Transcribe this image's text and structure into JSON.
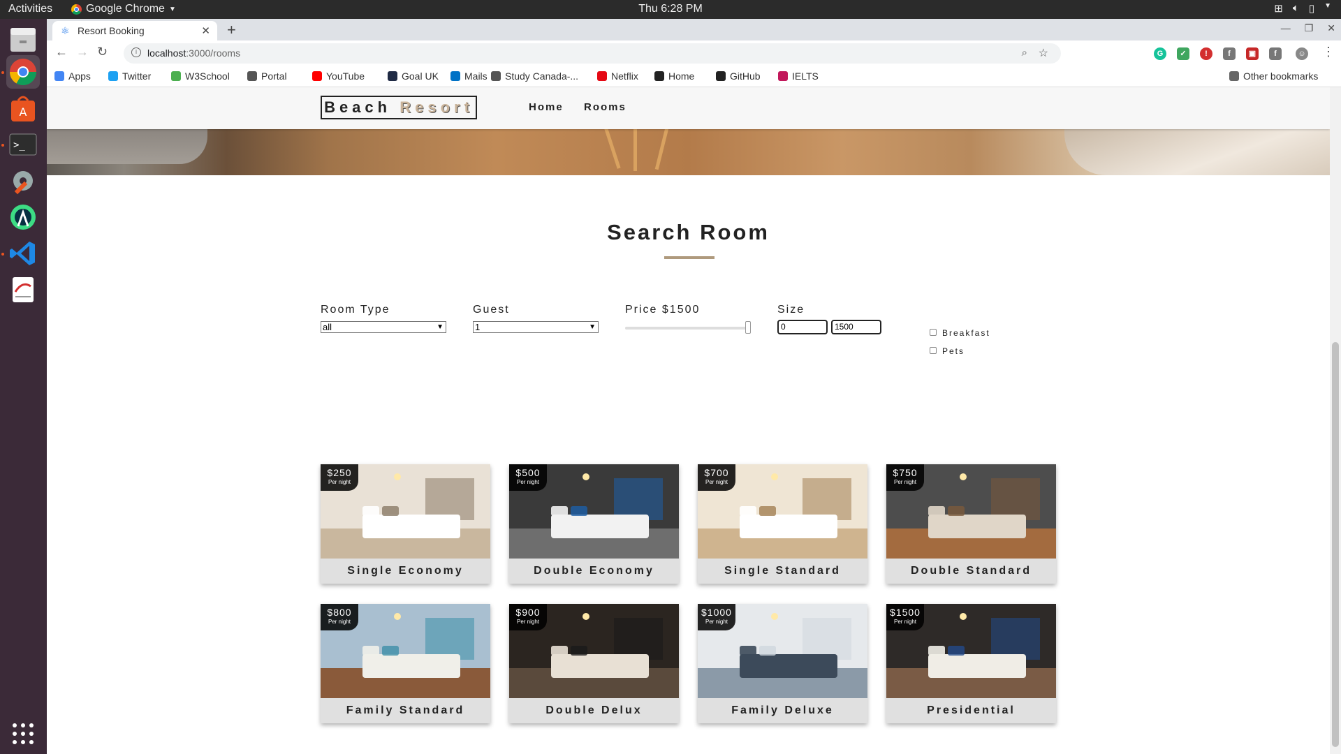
{
  "os": {
    "activities": "Activities",
    "app_name": "Google Chrome",
    "clock": "Thu  6:28 PM"
  },
  "browser": {
    "tab_title": "Resort Booking",
    "url_host": "localhost",
    "url_path": ":3000/rooms",
    "bookmarks": [
      {
        "label": "Apps",
        "icon": "apps-grid-icon",
        "color": "#4285f4"
      },
      {
        "label": "Twitter",
        "icon": "twitter-icon",
        "color": "#1da1f2"
      },
      {
        "label": "W3School",
        "icon": "w3school-icon",
        "color": "#4caf50"
      },
      {
        "label": "Portal",
        "icon": "globe-icon",
        "color": "#555555"
      },
      {
        "label": "YouTube",
        "icon": "youtube-icon",
        "color": "#ff0000"
      },
      {
        "label": "Goal UK",
        "icon": "goal-icon",
        "color": "#1f2a44"
      },
      {
        "label": "Mails",
        "icon": "outlook-icon",
        "color": "#0072c6"
      },
      {
        "label": "Study Canada-...",
        "icon": "globe-icon",
        "color": "#555555"
      },
      {
        "label": "Netflix",
        "icon": "netflix-icon",
        "color": "#e50914"
      },
      {
        "label": "Home",
        "icon": "home-site-icon",
        "color": "#222222"
      },
      {
        "label": "GitHub",
        "icon": "github-icon",
        "color": "#222222"
      },
      {
        "label": "IELTS",
        "icon": "ielts-icon",
        "color": "#c2185b"
      }
    ],
    "other_bookmarks": "Other bookmarks"
  },
  "site": {
    "logo_word1": "Beach",
    "logo_word2": "Resort",
    "nav": [
      "Home",
      "Rooms"
    ]
  },
  "search": {
    "title": "Search Room",
    "room_type_label": "Room Type",
    "room_type_value": "all",
    "guest_label": "Guest",
    "guest_value": "1",
    "price_label": "Price $1500",
    "price_fraction": 1.0,
    "size_label": "Size",
    "size_min": "0",
    "size_max": "1500",
    "breakfast_label": "Breakfast",
    "breakfast_checked": false,
    "pets_label": "Pets",
    "pets_checked": false
  },
  "rooms": [
    {
      "name": "Single Economy",
      "price": "$250",
      "per": "Per night"
    },
    {
      "name": "Double Economy",
      "price": "$500",
      "per": "Per night"
    },
    {
      "name": "Single Standard",
      "price": "$700",
      "per": "Per night"
    },
    {
      "name": "Double Standard",
      "price": "$750",
      "per": "Per night"
    },
    {
      "name": "Family Standard",
      "price": "$800",
      "per": "Per night"
    },
    {
      "name": "Double Delux",
      "price": "$900",
      "per": "Per night"
    },
    {
      "name": "Family Deluxe",
      "price": "$1000",
      "per": "Per night"
    },
    {
      "name": "Presidential",
      "price": "$1500",
      "per": "Per night"
    }
  ],
  "colors": {
    "accent": "#af9a7d",
    "dock": "#3b2a38",
    "topbar": "#2b2b2b"
  }
}
